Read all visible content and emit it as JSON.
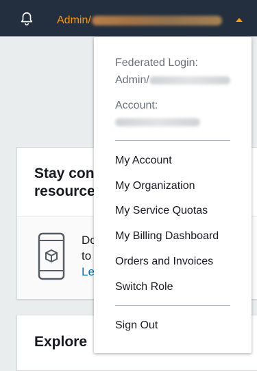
{
  "topbar": {
    "account_label": "Admin/"
  },
  "background": {
    "card1_title_line1": "Stay con",
    "card1_title_line2": "resource",
    "card1_text_line1": "Do",
    "card1_text_line2": "to",
    "card1_link": "Le",
    "card2_title": "Explore"
  },
  "dropdown": {
    "federated_label": "Federated Login:",
    "federated_value_prefix": "Admin/",
    "account_label": "Account:",
    "items": [
      {
        "label": "My Account"
      },
      {
        "label": "My Organization"
      },
      {
        "label": "My Service Quotas"
      },
      {
        "label": "My Billing Dashboard"
      },
      {
        "label": "Orders and Invoices"
      },
      {
        "label": "Switch Role"
      }
    ],
    "sign_out": "Sign Out"
  },
  "colors": {
    "topbar_bg": "#232f3e",
    "accent": "#ff9900",
    "link": "#0073bb"
  }
}
